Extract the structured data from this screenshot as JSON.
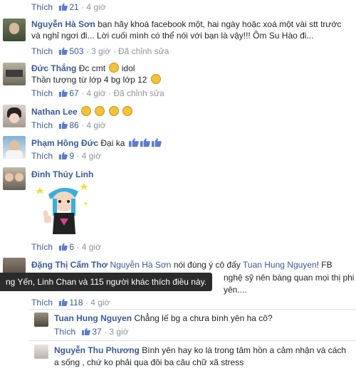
{
  "top": {
    "like_label": "Thích",
    "likes": "21",
    "time": "4 giờ"
  },
  "comments": [
    {
      "name": "Nguyễn Hà Sơn",
      "text": "bạn hãy khoá facebook một, hai ngày hoặc xoá một vài stt trước và nghỉ ngơi đi... Lời cuối mình có thể nói với bạn là vậy!!! Ôm Su Hào đi...",
      "like_label": "Thích",
      "likes": "503",
      "time": "3 giờ",
      "edited": "Đã chỉnh sửa"
    },
    {
      "name": "Đức Thắng",
      "text": "Đc cmt",
      "text2": "idol",
      "line2": "Thần tượng từ lớp 4 bg lớp 12",
      "like_label": "Thích",
      "likes": "67",
      "time": "4 giờ",
      "edited": "Đã chỉnh sửa"
    },
    {
      "name": "Nathan Lee",
      "like_label": "Thích",
      "likes": "86",
      "time": "4 giờ"
    },
    {
      "name": "Phạm Hồng Đức",
      "text": "Đại ka",
      "like_label": "Thích",
      "likes": "9",
      "time": "4 giờ"
    },
    {
      "name": "Đinh Thủy Linh",
      "like_label": "Thích",
      "likes": "6",
      "time": "4 giờ"
    },
    {
      "name": "Đặng Thị Cẩm Thơ",
      "mention1": "Nguyễn Hà Sơn",
      "text_a": "nói đúng ý cô đấy",
      "mention2": "Tuan Hung Nguyen",
      "text_b": "! FB",
      "line2_tail": "nghệ sỹ nên bàng quan mọi thị phi",
      "line3_tail": "yên....",
      "like_label": "Thích",
      "likes": "118",
      "time": "4 giờ"
    }
  ],
  "tooltip": "ng Yến, Linh Chan và 115 người khác thích điều này.",
  "replies": [
    {
      "name": "Tuan Hung Nguyen",
      "text": "Chẳng lế bg a chưa bình yên ha cô?",
      "like_label": "Thích",
      "likes": "37",
      "time": "3 giờ"
    },
    {
      "name": "Nguyễn Thu Phương",
      "text": "Bình yên hay ko là trong tâm hồn a cảm nhận và cách a sống , chứ ko phải qua đôi ba câu chữ xã stress"
    }
  ],
  "colors": {
    "link": "#3b5998",
    "meta": "#90949c",
    "tooltip_bg": "#2b2b2b"
  }
}
